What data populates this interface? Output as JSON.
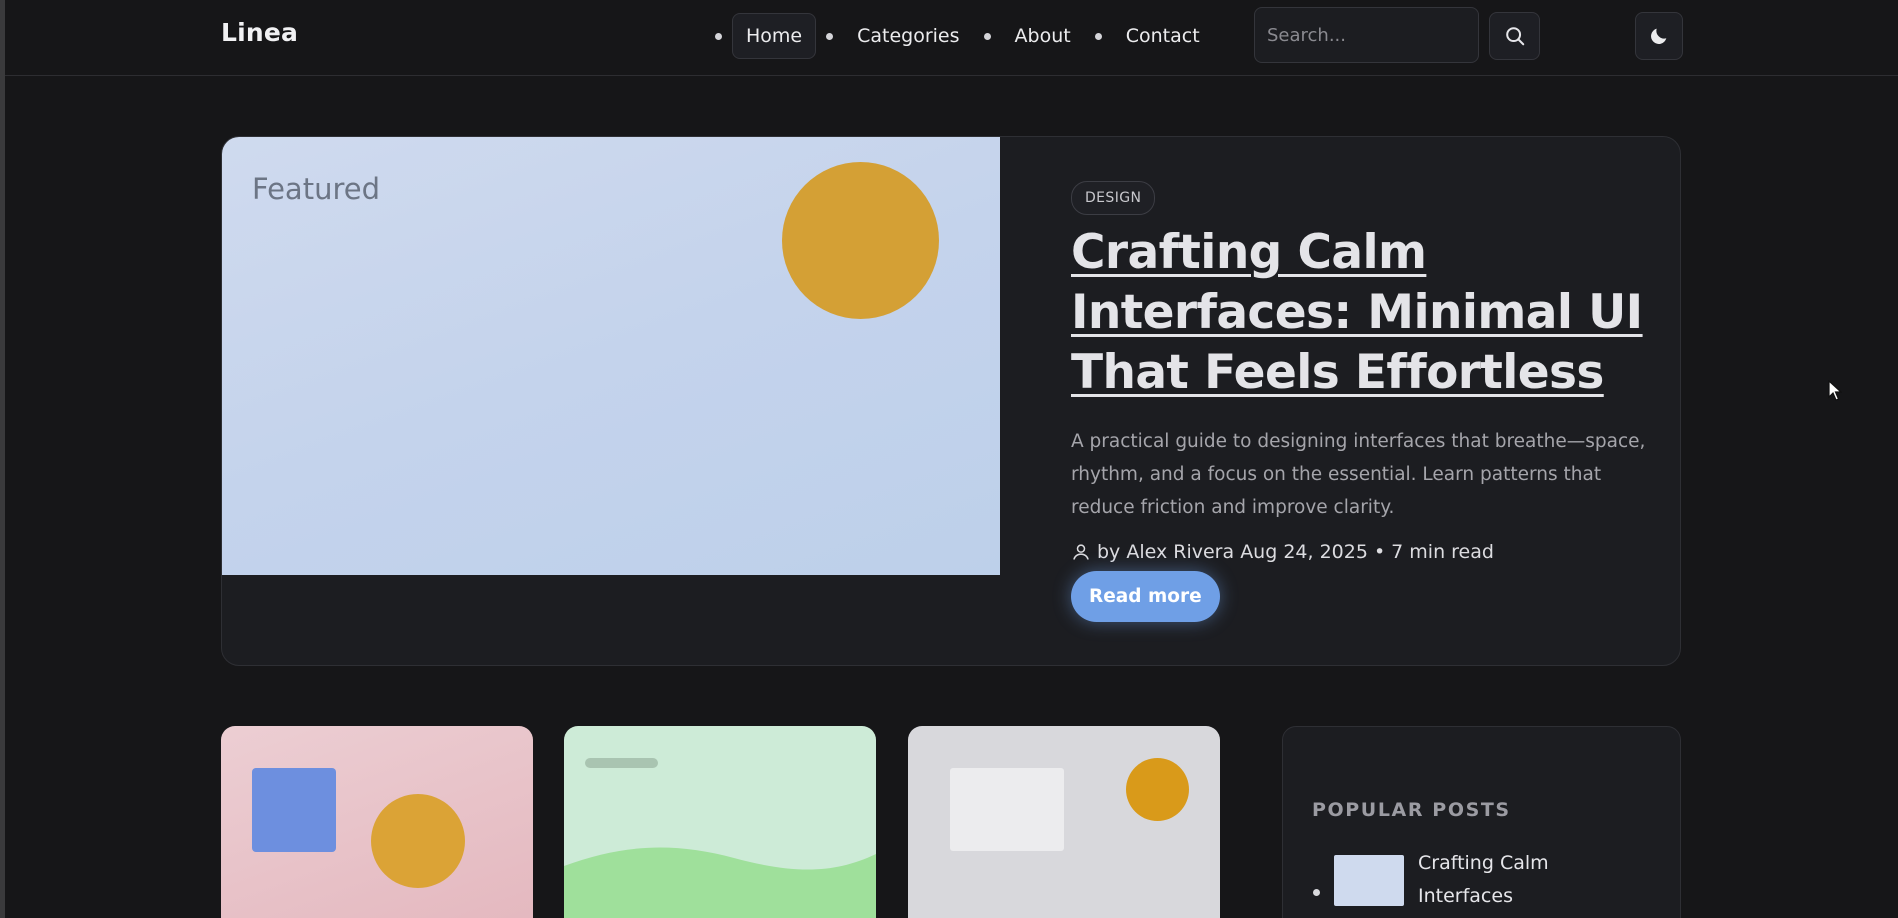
{
  "header": {
    "logo": "Linea",
    "nav": [
      {
        "label": "Home",
        "active": true
      },
      {
        "label": "Categories",
        "active": false
      },
      {
        "label": "About",
        "active": false
      },
      {
        "label": "Contact",
        "active": false
      }
    ],
    "search_placeholder": "Search...",
    "search_icon": "search-icon",
    "theme_icon": "moon-icon"
  },
  "featured": {
    "image_label": "Featured",
    "tag": "DESIGN",
    "title": "Crafting Calm Interfaces: Minimal UI That Feels Effortless",
    "excerpt": "A practical guide to designing interfaces that breathe—space, rhythm, and a focus on the essential. Learn patterns that reduce friction and improve clarity.",
    "author": "by Alex Rivera",
    "date": "Aug 24, 2025",
    "separator": "•",
    "read_time": "7 min read",
    "read_more": "Read more"
  },
  "sidebar": {
    "title": "POPULAR POSTS",
    "items": [
      {
        "title": "Crafting Calm Interfaces"
      }
    ]
  },
  "colors": {
    "background": "#161618",
    "card": "#1c1d21",
    "accent": "#6f9fe6",
    "sun": "#d4a035"
  }
}
